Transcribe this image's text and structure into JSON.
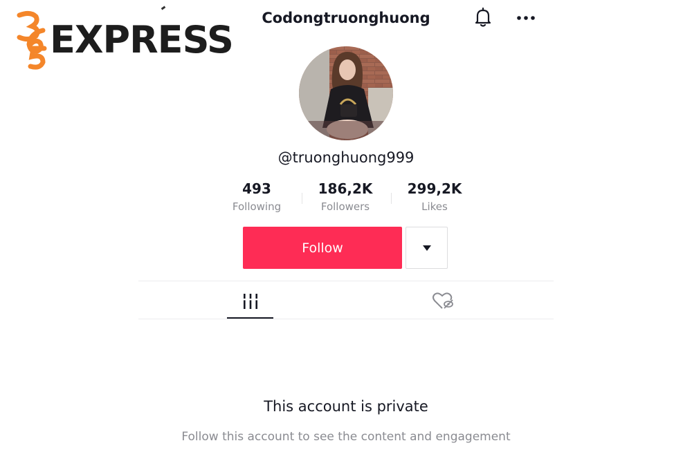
{
  "watermark": {
    "text": "EXPRESS",
    "mark_digits": "365",
    "accent_color": "#f4862a"
  },
  "header": {
    "title": "Codongtruonghuong",
    "bell_icon": "bell-icon",
    "more_icon": "more-horizontal-icon"
  },
  "profile": {
    "avatar": "profile-photo",
    "username": "@truonghuong999"
  },
  "stats": [
    {
      "value": "493",
      "label": "Following"
    },
    {
      "value": "186,2K",
      "label": "Followers"
    },
    {
      "value": "299,2K",
      "label": "Likes"
    }
  ],
  "actions": {
    "follow_label": "Follow",
    "follow_color": "#fe2c55",
    "dropdown_icon": "caret-down-icon"
  },
  "tabs": [
    {
      "name": "videos",
      "icon": "grid-bars-icon",
      "active": true
    },
    {
      "name": "liked",
      "icon": "hidden-heart-icon",
      "active": false
    }
  ],
  "private": {
    "title": "This account is private",
    "description": "Follow this account to see the content and engagement"
  }
}
